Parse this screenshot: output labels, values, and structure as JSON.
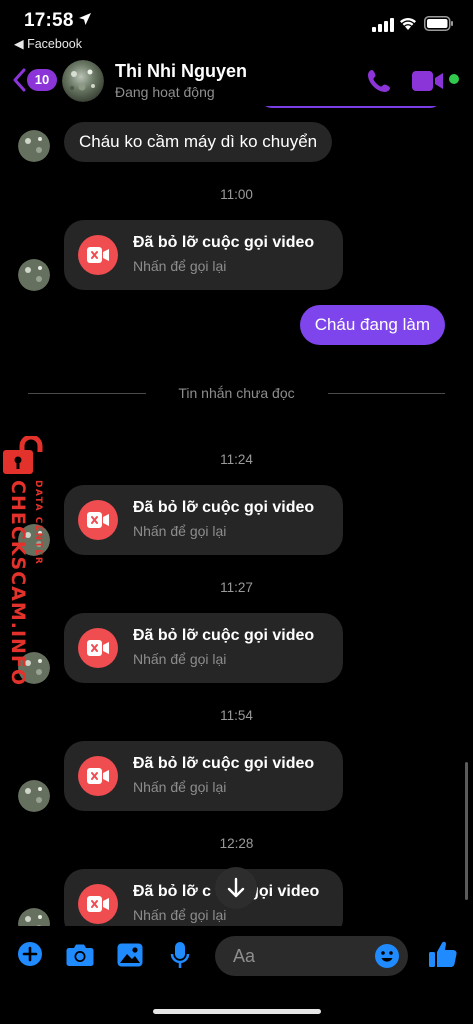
{
  "status_bar": {
    "time": "17:58",
    "back_app": "◀ Facebook"
  },
  "header": {
    "unread_count": "10",
    "contact_name": "Thi Nhi Nguyen",
    "contact_status": "Đang hoạt động"
  },
  "messages": {
    "incoming_1": "Cháu ko cầm máy dì ko chuyển",
    "time_1": "11:00",
    "outgoing_1": "Cháu đang làm",
    "unread_divider": "Tin nhắn chưa đọc",
    "time_2": "11:24",
    "time_3": "11:27",
    "time_4": "11:54",
    "time_5": "12:28",
    "missed_call_title": "Đã bỏ lỡ cuộc gọi video",
    "missed_call_sub": "Nhấn để gọi lại",
    "last_call_title_a": "Đã bỏ lỡ c",
    "last_call_title_b": "gọi video"
  },
  "watermark": {
    "main": "CHECKSCAM.INFO",
    "small": "DATA CENTER"
  },
  "composer": {
    "placeholder": "Aa"
  },
  "colors": {
    "accent": "#7e45ec",
    "missed_call": "#ef4d50",
    "composer_icons": "#1f8bff",
    "online": "#31c94e",
    "watermark": "#e3322b"
  }
}
